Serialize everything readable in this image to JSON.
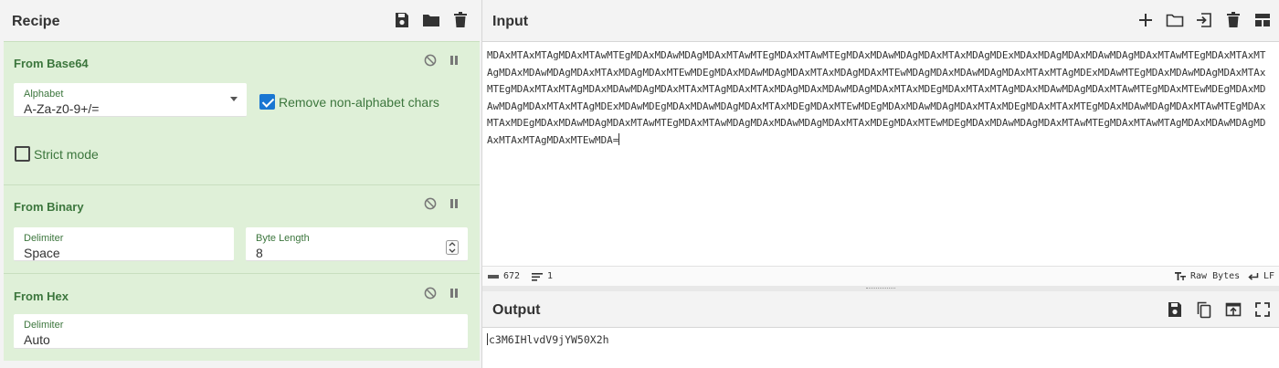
{
  "recipe": {
    "title": "Recipe",
    "header_icons": [
      "save-icon",
      "folder-icon",
      "trash-icon"
    ],
    "operations": [
      {
        "title": "From Base64",
        "alphabet_label": "Alphabet",
        "alphabet_value": "A-Za-z0-9+/=",
        "remove_nonalpha_label": "Remove non-alphabet chars",
        "remove_nonalpha_checked": true,
        "strict_mode_label": "Strict mode",
        "strict_mode_checked": false
      },
      {
        "title": "From Binary",
        "delimiter_label": "Delimiter",
        "delimiter_value": "Space",
        "byte_length_label": "Byte Length",
        "byte_length_value": "8"
      },
      {
        "title": "From Hex",
        "delimiter_label": "Delimiter",
        "delimiter_value": "Auto"
      }
    ]
  },
  "input": {
    "title": "Input",
    "header_icons": [
      "plus-icon",
      "folder-icon",
      "import-icon",
      "trash-icon",
      "layout-icon"
    ],
    "text": "MDAxMTAxMTAgMDAxMTAwMTEgMDAxMDAwMDAgMDAxMTAwMTEgMDAxMTAwMTEgMDAxMDAwMDAgMDAxMTAxMDAgMDExMDAxMDAgMDAxMDAwMDAgMDAxMTAwMTEgMDAxMTAxMTAgMDAxMDAwMDAgMDAxMTAxMDAgMDAxMTEwMDEgMDAxMDAwMDAgMDAxMTAxMDAgMDAxMTEwMDAgMDAxMDAwMDAgMDAxMTAxMTAgMDExMDAwMTEgMDAxMDAwMDAgMDAxMTAxMTEgMDAxMTAxMTAgMDAxMDAwMDAgMDAxMTAxMTAgMDAxMTAxMDAgMDAxMDAwMDAgMDAxMTAxMDEgMDAxMTAxMTAgMDAxMDAwMDAgMDAxMTAwMTEgMDAxMTEwMDEgMDAxMDAwMDAgMDAxMTAxMTAgMDExMDAwMDEgMDAxMDAwMDAgMDAxMTAxMDEgMDAxMTEwMDEgMDAxMDAwMDAgMDAxMTAxMDEgMDAxMTAxMTEgMDAxMDAwMDAgMDAxMTAwMTEgMDAxMTAxMDEgMDAxMDAwMDAgMDAxMTAwMTEgMDAxMTAwMDAgMDAxMDAwMDAgMDAxMTAxMDEgMDAxMTEwMDEgMDAxMDAwMDAgMDAxMTAwMTEgMDAxMTAwMTAgMDAxMDAwMDAgMDAxMTAxMTAgMDAxMTEwMDA=",
    "status": {
      "length_icon": "abc-icon",
      "length": "672",
      "lines_icon": "lines-icon",
      "lines": "1",
      "raw_icon": "text-size-icon",
      "raw_label": "Raw Bytes",
      "eol_icon": "return-icon",
      "eol_label": "LF"
    }
  },
  "output": {
    "title": "Output",
    "header_icons": [
      "save-icon",
      "copy-icon",
      "replace-input-icon",
      "maximize-icon"
    ],
    "text": "c3M6IHlvdV9jYW50X2h"
  },
  "colors": {
    "op_bg": "#dff0d8",
    "op_text": "#3c763d",
    "panel_bg": "#f3f3f3",
    "checkbox_on": "#1976d2"
  }
}
